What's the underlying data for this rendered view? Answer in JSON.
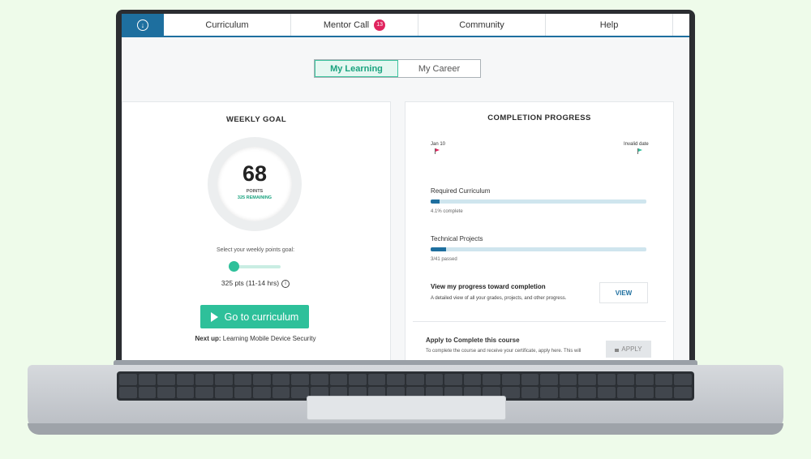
{
  "nav": {
    "items": [
      {
        "label": "Curriculum"
      },
      {
        "label": "Mentor Call",
        "badge": "13"
      },
      {
        "label": "Community"
      },
      {
        "label": "Help"
      }
    ]
  },
  "toggle": {
    "options": [
      "My Learning",
      "My Career"
    ],
    "active": "My Learning"
  },
  "weekly_goal": {
    "title": "WEEKLY GOAL",
    "points": "68",
    "points_label": "POINTS",
    "remaining": "325 REMAINING",
    "slider_label": "Select your weekly points goal:",
    "slider_level": 0.05,
    "pts_text": "325 pts (11-14 hrs)",
    "button_label": "Go to curriculum",
    "next_up_label": "Next up:",
    "next_up_value": "Learning Mobile Device Security"
  },
  "completion": {
    "title": "COMPLETION PROGRESS",
    "start_date": "Jan 10",
    "end_date": "Invalid date",
    "required_label": "Required Curriculum",
    "required_progress": 0.041,
    "required_sub": "4.1% complete",
    "projects_label": "Technical Projects",
    "projects_progress": 0.073,
    "projects_sub": "3/41 passed",
    "view_title": "View my progress toward completion",
    "view_desc": "A detailed view of all your grades, projects, and other progress.",
    "view_button": "VIEW",
    "apply_title": "Apply to Complete this course",
    "apply_desc": "To complete the course and receive your certificate, apply here. This will",
    "apply_button": "APPLY"
  },
  "colors": {
    "brand_blue": "#1e6f9f",
    "accent_green": "#2ec09a",
    "badge_red": "#e0245e"
  }
}
